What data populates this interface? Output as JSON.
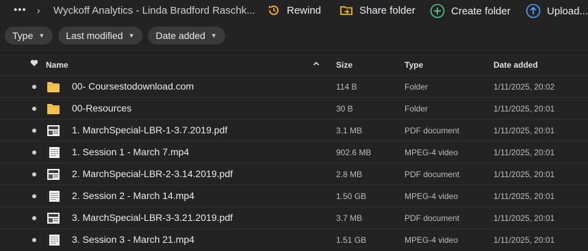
{
  "breadcrumb": {
    "more": "•••",
    "current": "Wyckoff Analytics - Linda Bradford Raschk..."
  },
  "toolbar": {
    "rewind": "Rewind",
    "share_folder": "Share folder",
    "create_folder": "Create folder",
    "upload": "Upload..."
  },
  "filters": {
    "type": "Type",
    "last_modified": "Last modified",
    "date_added": "Date added"
  },
  "columns": {
    "name": "Name",
    "size": "Size",
    "type": "Type",
    "date_added": "Date added"
  },
  "files": [
    {
      "name": "00- Coursestodownload.com",
      "size": "114 B",
      "type": "Folder",
      "date": "1/11/2025, 20:02",
      "icon": "folder-icon"
    },
    {
      "name": "00-Resources",
      "size": "30 B",
      "type": "Folder",
      "date": "1/11/2025, 20:01",
      "icon": "folder-icon"
    },
    {
      "name": "1. MarchSpecial-LBR-1-3.7.2019.pdf",
      "size": "3.1 MB",
      "type": "PDF document",
      "date": "1/11/2025, 20:01",
      "icon": "pdf-thumbnail-icon"
    },
    {
      "name": "1. Session 1 - March 7.mp4",
      "size": "902.6 MB",
      "type": "MPEG-4 video",
      "date": "1/11/2025, 20:01",
      "icon": "video-thumbnail-icon"
    },
    {
      "name": "2. MarchSpecial-LBR-2-3.14.2019.pdf",
      "size": "2.8 MB",
      "type": "PDF document",
      "date": "1/11/2025, 20:01",
      "icon": "pdf-thumbnail-icon"
    },
    {
      "name": "2. Session 2 - March 14.mp4",
      "size": "1.50 GB",
      "type": "MPEG-4 video",
      "date": "1/11/2025, 20:01",
      "icon": "video-thumbnail-icon"
    },
    {
      "name": "3. MarchSpecial-LBR-3-3.21.2019.pdf",
      "size": "3.7 MB",
      "type": "PDF document",
      "date": "1/11/2025, 20:01",
      "icon": "pdf-thumbnail-icon"
    },
    {
      "name": "3. Session 3 - March 21.mp4",
      "size": "1.51 GB",
      "type": "MPEG-4 video",
      "date": "1/11/2025, 20:01",
      "icon": "video-thumbnail-icon"
    }
  ],
  "colors": {
    "background": "#232323",
    "rewind_accent": "#f5a623",
    "share_accent": "#f5b800",
    "create_accent": "#4fc98f",
    "upload_accent": "#4da3ff",
    "folder": "#f2c14e"
  }
}
